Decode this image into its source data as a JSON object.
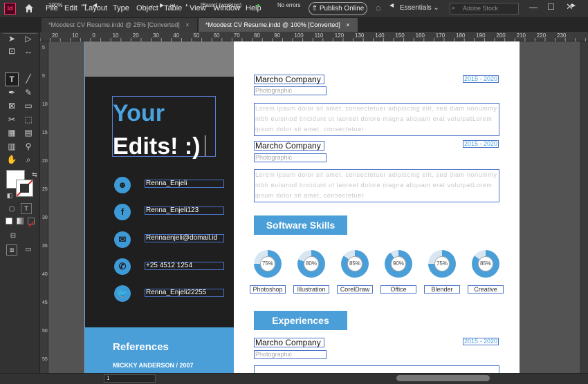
{
  "menubar": {
    "app_icon": "Id",
    "items": [
      "File",
      "Edit",
      "Layout",
      "Type",
      "Object",
      "Table",
      "View",
      "Window",
      "Help"
    ],
    "publish_label": "Publish Online",
    "workspace": "Essentials",
    "search_placeholder": "Adobe Stock"
  },
  "tabs": [
    {
      "label": "*Moodest CV Resume.indd @ 25% [Converted]",
      "close": "×"
    },
    {
      "label": "*Moodest CV Resume.indd @ 100% [Converted]",
      "close": "×"
    }
  ],
  "ruler": {
    "top_marks": [
      "20",
      "10",
      "0",
      "10",
      "20",
      "30",
      "40",
      "50",
      "60",
      "70",
      "80",
      "90",
      "100",
      "110",
      "120",
      "130",
      "140",
      "150",
      "160",
      "170",
      "180",
      "190",
      "200",
      "210",
      "220",
      "230"
    ],
    "left_marks": [
      "5",
      "",
      "5",
      "",
      "10",
      "",
      "15",
      "",
      "20",
      "",
      "25",
      "",
      "30",
      "",
      "35",
      "",
      "40",
      "",
      "45",
      "",
      "50",
      "",
      "55"
    ]
  },
  "resume": {
    "headline_1": "Your",
    "headline_2": "Edits! :)",
    "contacts": [
      {
        "icon": "person-icon",
        "text": "Renna_Enjeli"
      },
      {
        "icon": "facebook-icon",
        "text": "Renna_Enjeli123"
      },
      {
        "icon": "mail-icon",
        "text": "Rennaenjeli@domail.id"
      },
      {
        "icon": "phone-icon",
        "text": "+25 4512 1254"
      },
      {
        "icon": "twitter-icon",
        "text": "Renna_Enjeli22255"
      }
    ],
    "references_title": "References",
    "references_name": "MICKKY ANDERSON / 2007",
    "experience": [
      {
        "company": "Marcho Company",
        "role": "Photographic",
        "years": "2015 - 2020",
        "desc": "Lorem ipsum dolor sit amet, consectetuer adipiscing elit, sed diam nonummy nibh euismod tincidunt ut laoreet dolore magna aliquam erat volutpatLorem ipsum dolor sit amet, consectetuer"
      },
      {
        "company": "Marcho Company",
        "role": "Photographic",
        "years": "2015 - 2020",
        "desc": "Lorem ipsum dolor sit amet, consectetuer adipiscing elit, sed diam nonummy nibh euismod tincidunt ut laoreet dolore magna aliquam erat volutpatLorem ipsum dolor sit amet, consectetuer"
      },
      {
        "company": "Marcho Company",
        "role": "Photographic",
        "years": "2015 - 2020"
      }
    ],
    "software_title": "Software Skills",
    "skills": [
      {
        "name": "Photoshop",
        "pct": "75%",
        "value": 75
      },
      {
        "name": "Illustration",
        "pct": "80%",
        "value": 80
      },
      {
        "name": "CorelDraw",
        "pct": "85%",
        "value": 85
      },
      {
        "name": "Office",
        "pct": "90%",
        "value": 90
      },
      {
        "name": "Blender",
        "pct": "75%",
        "value": 75
      },
      {
        "name": "Creative",
        "pct": "85%",
        "value": 85
      }
    ],
    "experiences_title": "Experiences"
  },
  "statusbar": {
    "zoom": "100%",
    "page": "1",
    "style": "[Basic] (working)",
    "errors": "No errors"
  },
  "colors": {
    "accent": "#4a9fd8",
    "dark_panel": "#1f1f20",
    "frame": "#4a72c7"
  }
}
